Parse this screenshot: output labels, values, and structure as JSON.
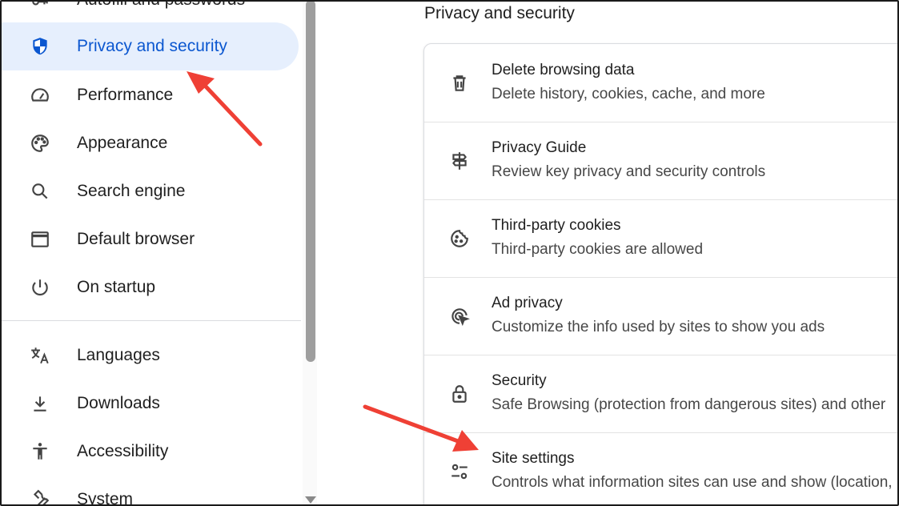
{
  "sidebar": {
    "items": [
      {
        "label": "Autofill and passwords",
        "icon": "autofill-icon"
      },
      {
        "label": "Privacy and security",
        "icon": "shield-icon",
        "active": true
      },
      {
        "label": "Performance",
        "icon": "speedometer-icon"
      },
      {
        "label": "Appearance",
        "icon": "palette-icon"
      },
      {
        "label": "Search engine",
        "icon": "search-icon"
      },
      {
        "label": "Default browser",
        "icon": "browser-window-icon"
      },
      {
        "label": "On startup",
        "icon": "power-icon"
      },
      {
        "label": "Languages",
        "icon": "translate-icon"
      },
      {
        "label": "Downloads",
        "icon": "download-icon"
      },
      {
        "label": "Accessibility",
        "icon": "accessibility-icon"
      },
      {
        "label": "System",
        "icon": "wrench-icon"
      }
    ]
  },
  "main": {
    "section_title": "Privacy and security",
    "rows": [
      {
        "title": "Delete browsing data",
        "subtitle": "Delete history, cookies, cache, and more",
        "icon": "trash-icon"
      },
      {
        "title": "Privacy Guide",
        "subtitle": "Review key privacy and security controls",
        "icon": "signpost-icon"
      },
      {
        "title": "Third-party cookies",
        "subtitle": "Third-party cookies are allowed",
        "icon": "cookie-icon"
      },
      {
        "title": "Ad privacy",
        "subtitle": "Customize the info used by sites to show you ads",
        "icon": "ad-privacy-icon"
      },
      {
        "title": "Security",
        "subtitle": "Safe Browsing (protection from dangerous sites) and other",
        "icon": "lock-icon"
      },
      {
        "title": "Site settings",
        "subtitle": "Controls what information sites can use and show (location,",
        "icon": "tune-icon"
      }
    ]
  },
  "colors": {
    "accent": "#0b57d0",
    "active_bg": "#e6effd",
    "annotation_arrow": "#ef4035"
  }
}
